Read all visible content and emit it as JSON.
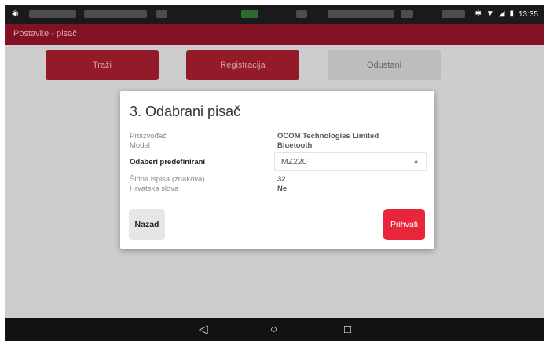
{
  "status_bar": {
    "time": "13:35",
    "icons": [
      "android-debug-icon",
      "bluetooth-icon",
      "wifi-icon",
      "signal-icon",
      "battery-icon"
    ]
  },
  "app_bar": {
    "title": "Postavke - pisač"
  },
  "background_buttons": {
    "search": "Traži",
    "register": "Registracija",
    "cancel": "Odustani"
  },
  "dialog": {
    "title": "3. Odabrani pisač",
    "fields": [
      {
        "label": "Proizvođač",
        "value": "OCOM Technologies Limited"
      },
      {
        "label": "Model",
        "value": "Bluetooth"
      }
    ],
    "select": {
      "label": "Odaberi predefinirani",
      "value": "IMZ220"
    },
    "extra_fields": [
      {
        "label": "Širina ispisa (znakova)",
        "value": "32"
      },
      {
        "label": "Hrvatska slova",
        "value": "Ne"
      }
    ],
    "back_label": "Nazad",
    "accept_label": "Prihvati"
  },
  "colors": {
    "app_bar": "#8a1225",
    "accept_button": "#e8253a",
    "status_bar": "#1a1a1a",
    "nav_bar": "#121212"
  },
  "nav_bar": {
    "icons": [
      "back-triangle-icon",
      "home-circle-icon",
      "recents-square-icon"
    ]
  }
}
